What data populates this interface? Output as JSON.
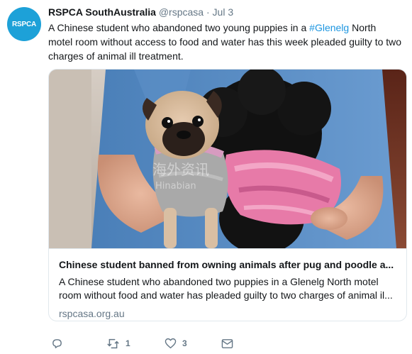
{
  "tweet": {
    "avatar_text": "RSPCA",
    "author_name": "RSPCA SouthAustralia",
    "handle": "@rspcasa",
    "separator": "·",
    "date": "Jul 3",
    "text_before": "A Chinese student who abandoned two young puppies in a ",
    "hashtag": "#Glenelg",
    "text_after": " North motel room without access to food and water has this week pleaded guilty to two charges of animal ill treatment."
  },
  "card": {
    "watermark_cn": "海外资讯",
    "watermark_en": "Hinabian",
    "title": "Chinese student banned from owning animals after pug and poodle a...",
    "description": "A Chinese student who abandoned two puppies in a Glenelg North motel room without food and water has pleaded guilty to two charges of animal il...",
    "domain": "rspcasa.org.au"
  },
  "actions": {
    "reply_icon": "reply-icon",
    "retweet_icon": "retweet-icon",
    "retweet_count": "1",
    "like_icon": "heart-icon",
    "like_count": "3",
    "dm_icon": "envelope-icon"
  },
  "colors": {
    "accent": "#1b95e0",
    "secondary_text": "#657786",
    "border": "#e1e8ed",
    "avatar_bg": "#1da1d8"
  }
}
